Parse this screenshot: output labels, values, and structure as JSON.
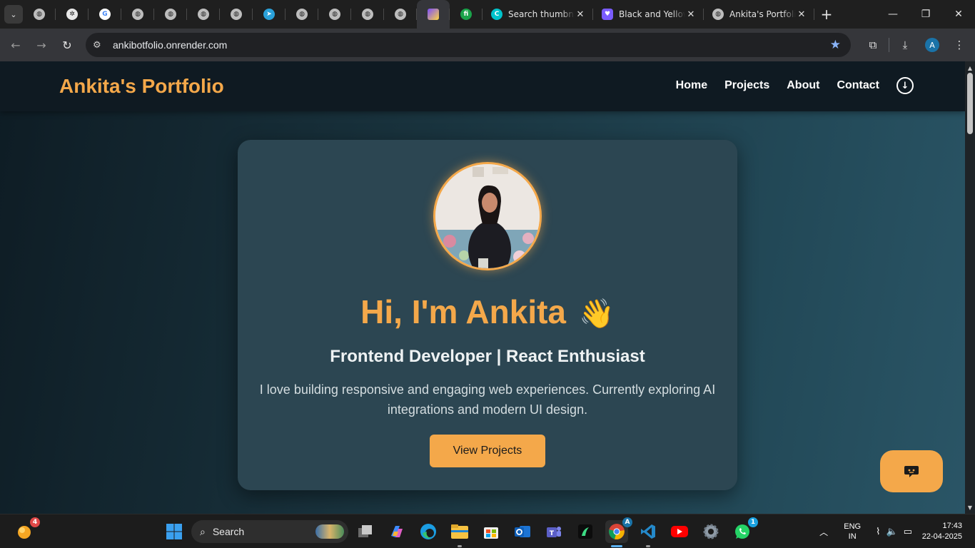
{
  "browser": {
    "pinned_tabs": [
      {
        "icon": "globe-icon"
      },
      {
        "icon": "openai-icon"
      },
      {
        "icon": "google-icon"
      },
      {
        "icon": "globe-icon"
      },
      {
        "icon": "globe-icon"
      },
      {
        "icon": "globe-icon"
      },
      {
        "icon": "globe-icon"
      },
      {
        "icon": "telegram-icon"
      },
      {
        "icon": "globe-icon"
      },
      {
        "icon": "globe-icon"
      },
      {
        "icon": "globe-icon"
      },
      {
        "icon": "globe-icon"
      },
      {
        "icon": "vite-icon",
        "active": true
      },
      {
        "icon": "green-app-icon"
      }
    ],
    "tabs": [
      {
        "title": "Search thumbnails",
        "icon": "canva-icon"
      },
      {
        "title": "Black and Yellow",
        "icon": "heart-icon"
      },
      {
        "title": "Ankita's Portfolio",
        "icon": "globe-icon"
      }
    ],
    "url": "ankibotfolio.onrender.com",
    "profile_initial": "A"
  },
  "site": {
    "brand": "Ankita's Portfolio",
    "nav": [
      "Home",
      "Projects",
      "About",
      "Contact"
    ],
    "hero": {
      "greeting": "Hi, I'm Ankita",
      "wave": "👋",
      "subtitle": "Frontend Developer | React Enthusiast",
      "bio": "I love building responsive and engaging web experiences. Currently exploring AI integrations and modern UI design.",
      "cta": "View Projects"
    }
  },
  "taskbar": {
    "search_placeholder": "Search",
    "weather_badge": "4",
    "whatsapp_badge": "1",
    "chrome_badge": "A",
    "language": "ENG",
    "region": "IN",
    "time": "17:43",
    "date": "22-04-2025"
  },
  "colors": {
    "accent": "#f4a84a",
    "navbar": "#0f1a22",
    "card": "#2c4652"
  }
}
